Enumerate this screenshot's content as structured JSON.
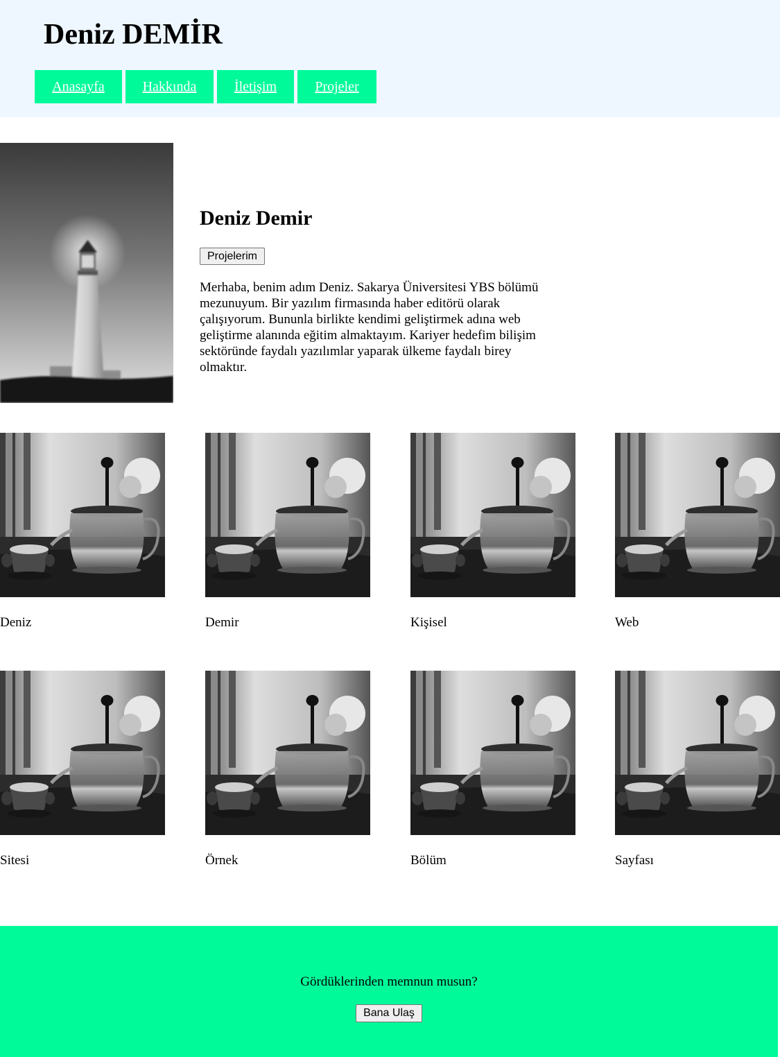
{
  "header": {
    "title": "Deniz DEMİR",
    "nav": [
      "Anasayfa",
      "Hakkında",
      "İletişim",
      "Projeler"
    ]
  },
  "profile": {
    "image": "lighthouse-photo",
    "name": "Deniz Demir",
    "button_label": "Projelerim",
    "bio": "Merhaba, benim adım Deniz. Sakarya Üniversitesi YBS bölümü mezunuyum. Bir yazılım firmasında haber editörü olarak çalışıyorum. Bununla birlikte kendimi geliştirmek adına web geliştirme alanında eğitim almaktayım. Kariyer hedefim bilişim sektöründe faydalı yazılımlar yaparak ülkeme faydalı birey olmaktır."
  },
  "gallery": {
    "image": "teapot-photo",
    "items": [
      "Deniz",
      "Demir",
      "Kişisel",
      "Web",
      "Sitesi",
      "Örnek",
      "Bölüm",
      "Sayfası"
    ]
  },
  "footer": {
    "text": "Gördüklerinden memnun musun?",
    "button_label": "Bana Ulaş"
  },
  "colors": {
    "header_bg": "#eef7ff",
    "accent": "#00fa9a",
    "nav_text": "#ffffff"
  }
}
